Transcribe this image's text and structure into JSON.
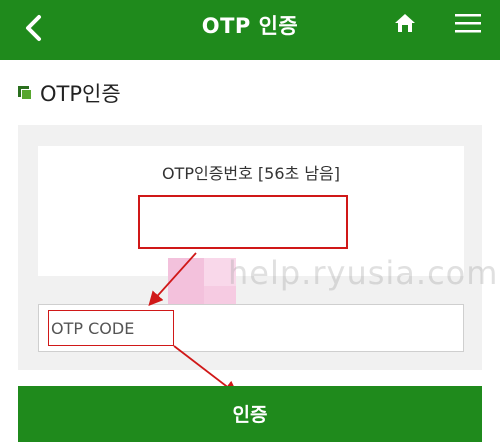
{
  "header": {
    "title": "OTP 인증",
    "background_color": "#1f8a1c",
    "back_icon": "chevron-left-icon",
    "home_icon": "home-icon",
    "menu_icon": "hamburger-menu-icon"
  },
  "section": {
    "title": "OTP인증",
    "icon": "stacked-squares-icon"
  },
  "otp": {
    "label": "OTP인증번호 [56초 남음]",
    "number_value": ""
  },
  "input": {
    "placeholder": "OTP CODE",
    "value": ""
  },
  "submit": {
    "label": "인증"
  },
  "watermark": {
    "text": "help.ryusia.com"
  },
  "colors": {
    "accent": "#1f8a1c",
    "annotation_red": "#d01818",
    "panel_bg": "#f1f1f1"
  }
}
